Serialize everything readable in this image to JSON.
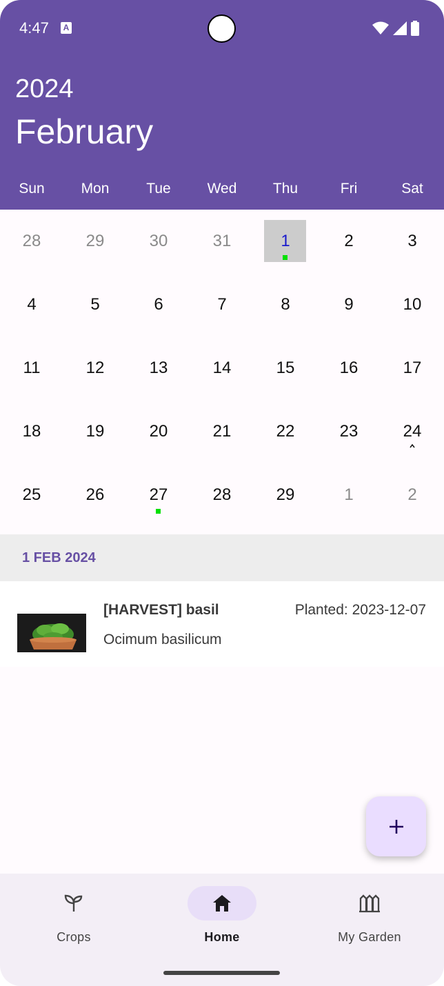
{
  "status_bar": {
    "time": "4:47",
    "a_badge": "A"
  },
  "header": {
    "year": "2024",
    "month": "February"
  },
  "weekdays": [
    "Sun",
    "Mon",
    "Tue",
    "Wed",
    "Thu",
    "Fri",
    "Sat"
  ],
  "calendar": {
    "weeks": [
      [
        "28",
        "29",
        "30",
        "31",
        "1",
        "2",
        "3"
      ],
      [
        "4",
        "5",
        "6",
        "7",
        "8",
        "9",
        "10"
      ],
      [
        "11",
        "12",
        "13",
        "14",
        "15",
        "16",
        "17"
      ],
      [
        "18",
        "19",
        "20",
        "21",
        "22",
        "23",
        "24"
      ],
      [
        "25",
        "26",
        "27",
        "28",
        "29",
        "1",
        "2"
      ]
    ],
    "selected": "1",
    "indicator_color": "#00e000"
  },
  "selected_date_label": "1 FEB 2024",
  "entry": {
    "title": "[HARVEST] basil",
    "planted": "Planted: 2023-12-07",
    "scientific_name": "Ocimum basilicum"
  },
  "fab": {
    "icon": "plus-icon"
  },
  "nav": {
    "crops": "Crops",
    "home": "Home",
    "garden": "My Garden"
  },
  "colors": {
    "primary": "#6750a4",
    "secondary_container": "#e8def8",
    "fab": "#eaddff"
  }
}
